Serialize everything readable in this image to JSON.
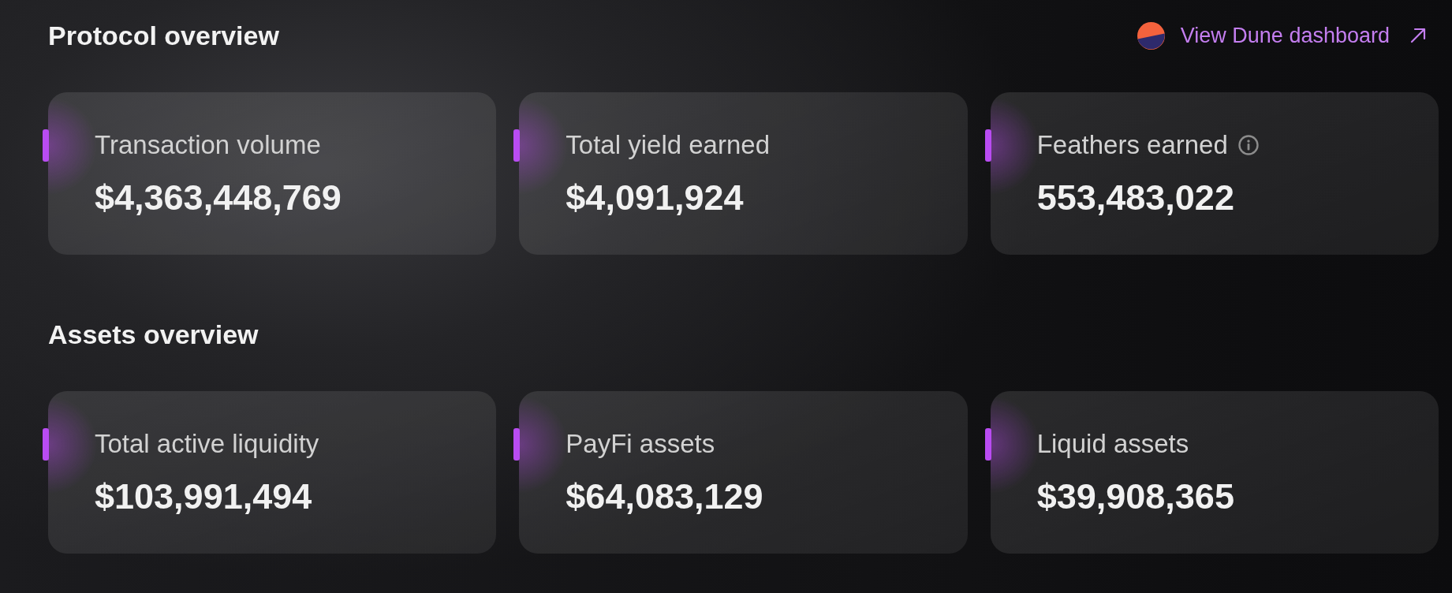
{
  "sections": [
    {
      "title": "Protocol overview",
      "link": {
        "label": "View Dune dashboard"
      },
      "cards": [
        {
          "label": "Transaction volume",
          "value": "$4,363,448,769",
          "info": false
        },
        {
          "label": "Total yield earned",
          "value": "$4,091,924",
          "info": false
        },
        {
          "label": "Feathers earned",
          "value": "553,483,022",
          "info": true
        }
      ]
    },
    {
      "title": "Assets overview",
      "cards": [
        {
          "label": "Total active liquidity",
          "value": "$103,991,494",
          "info": false
        },
        {
          "label": "PayFi assets",
          "value": "$64,083,129",
          "info": false
        },
        {
          "label": "Liquid assets",
          "value": "$39,908,365",
          "info": false
        }
      ]
    }
  ]
}
